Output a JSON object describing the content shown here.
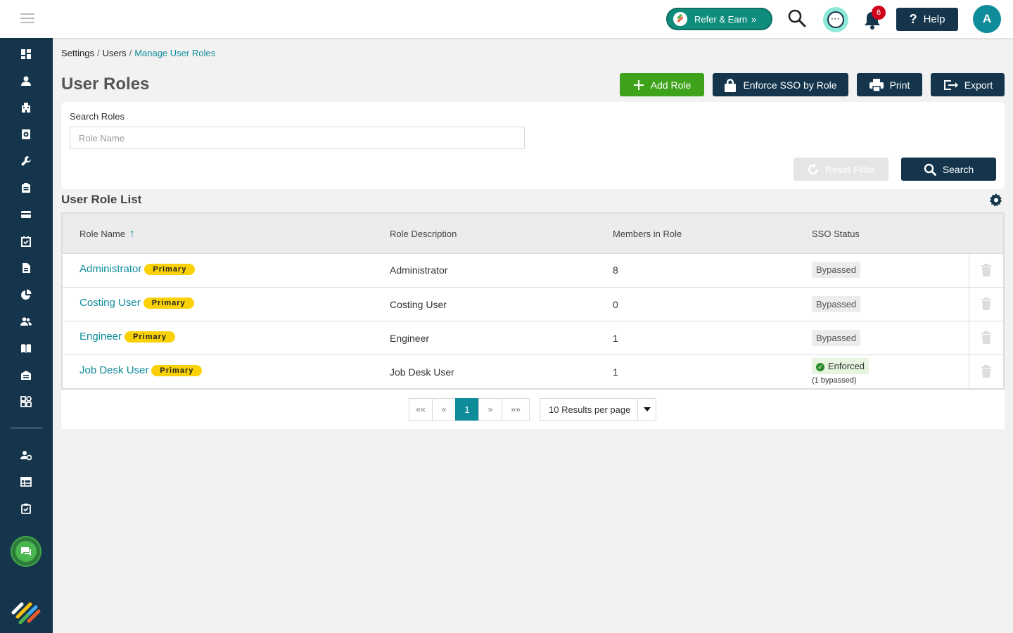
{
  "header": {
    "refer_label": "Refer & Earn",
    "refer_chevron": "»",
    "notification_count": "6",
    "help_icon": "?",
    "help_label": "Help",
    "avatar_initial": "A"
  },
  "sidebar": {
    "icons": [
      "dashboard-icon",
      "person-icon",
      "building-icon",
      "compass-doc-icon",
      "wrench-icon",
      "clipboard-icon",
      "card-icon",
      "calendar-check-icon",
      "document-icon",
      "pie-chart-icon",
      "people-icon",
      "book-icon",
      "warehouse-icon",
      "apps-icon",
      "user-settings-icon",
      "table-icon",
      "clipboard-check-icon"
    ],
    "chat_icon": "chat-icon",
    "logo": "brand-logo"
  },
  "breadcrumb": {
    "items": [
      "Settings",
      "Users"
    ],
    "separator": "/",
    "current": "Manage User Roles"
  },
  "page": {
    "title": "User Roles"
  },
  "toolbar": {
    "add_label": "Add Role",
    "sso_label": "Enforce SSO by Role",
    "print_label": "Print",
    "export_label": "Export"
  },
  "search": {
    "label": "Search Roles",
    "placeholder": "Role Name",
    "value": "",
    "reset_label": "Reset Filter",
    "search_label": "Search"
  },
  "list": {
    "title": "User Role List",
    "columns": {
      "role_name": "Role Name",
      "role_description": "Role Description",
      "members": "Members in Role",
      "sso_status": "SSO Status"
    },
    "sort_indicator": "↑",
    "rows": [
      {
        "name": "Administrator",
        "badge": "Primary",
        "description": "Administrator",
        "members": "8",
        "sso": "Bypassed",
        "sso_note": ""
      },
      {
        "name": "Costing User",
        "badge": "Primary",
        "description": "Costing User",
        "members": "0",
        "sso": "Bypassed",
        "sso_note": ""
      },
      {
        "name": "Engineer",
        "badge": "Primary",
        "description": "Engineer",
        "members": "1",
        "sso": "Bypassed",
        "sso_note": ""
      },
      {
        "name": "Job Desk User",
        "badge": "Primary",
        "description": "Job Desk User",
        "members": "1",
        "sso": "Enforced",
        "sso_note": "(1 bypassed)"
      }
    ]
  },
  "pagination": {
    "first": "««",
    "prev": "«",
    "current": "1",
    "next": "»",
    "last": "»»",
    "per_page": "10 Results per page"
  },
  "colors": {
    "sidebar": "#14354b",
    "accent": "#0e8c9a",
    "add_button": "#3fa21b",
    "primary_badge": "#fad106",
    "notification": "#d0021b"
  }
}
